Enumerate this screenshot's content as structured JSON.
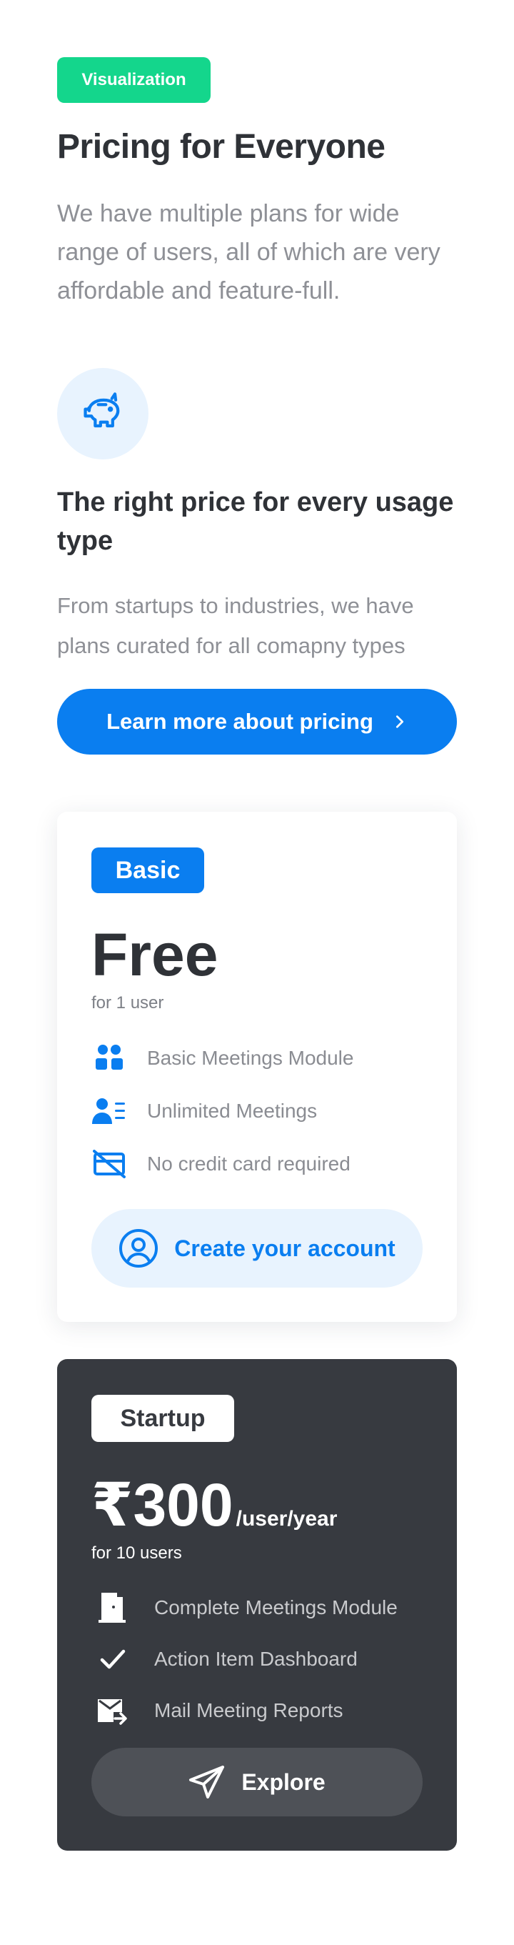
{
  "header": {
    "badge": "Visualization",
    "title": "Pricing for Everyone",
    "subtitle": "We have multiple plans for wide range of users, all of which are very affordable and feature-full."
  },
  "feature": {
    "icon": "piggy-bank-icon",
    "title": "The right price for every usage type",
    "description": "From startups to industries, we have plans curated for all comapny types",
    "cta_label": "Learn more about pricing"
  },
  "plans": {
    "basic": {
      "tag": "Basic",
      "price": "Free",
      "users": "for 1 user",
      "features": [
        "Basic Meetings Module",
        "Unlimited Meetings",
        "No credit card required"
      ],
      "button_label": "Create your account"
    },
    "startup": {
      "tag": "Startup",
      "price": "₹300",
      "period": "/user/year",
      "users": "for 10 users",
      "features": [
        "Complete Meetings Module",
        "Action Item Dashboard",
        "Mail Meeting Reports"
      ],
      "button_label": "Explore"
    }
  },
  "colors": {
    "accent": "#0a7ef0",
    "badge_green": "#14d68c",
    "dark_card": "#373a40",
    "light_blue": "#e8f3fe"
  }
}
